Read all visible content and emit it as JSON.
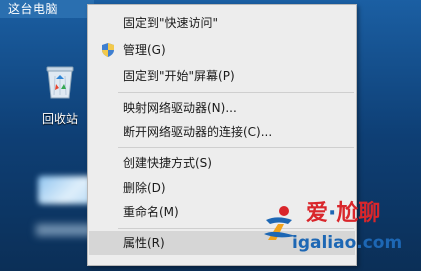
{
  "desktop": {
    "title_strip": "这台电脑",
    "recycle_bin_label": "回收站"
  },
  "context_menu": {
    "items": [
      {
        "label": "固定到\"快速访问\""
      },
      {
        "label": "管理(G)",
        "icon": "shield-icon"
      },
      {
        "label": "固定到\"开始\"屏幕(P)"
      },
      {
        "label": "映射网络驱动器(N)..."
      },
      {
        "label": "断开网络驱动器的连接(C)..."
      },
      {
        "label": "创建快捷方式(S)"
      },
      {
        "label": "删除(D)"
      },
      {
        "label": "重命名(M)"
      },
      {
        "label": "属性(R)",
        "state": "hovered"
      }
    ]
  },
  "watermark": {
    "cn_part1": "爱",
    "cn_dot": "·",
    "cn_part2": "尬聊",
    "url": "igaliao.com"
  },
  "colors": {
    "menu_bg": "#ededed",
    "menu_hover": "#d6d6d6",
    "watermark_red": "#d9262b",
    "watermark_blue": "#1d67b4"
  }
}
